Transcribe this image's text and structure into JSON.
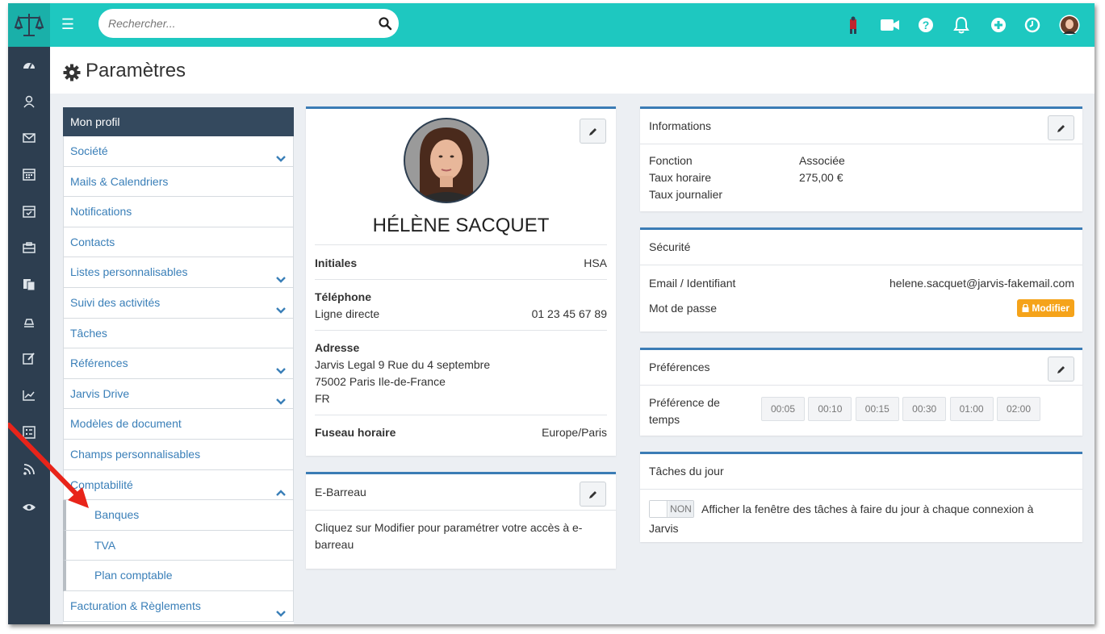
{
  "search": {
    "placeholder": "Rechercher..."
  },
  "header": {
    "title": "Paramètres"
  },
  "menu": {
    "head": "Mon profil",
    "items": [
      {
        "label": "Société",
        "chevron": "down"
      },
      {
        "label": "Mails & Calendriers"
      },
      {
        "label": "Notifications"
      },
      {
        "label": "Contacts"
      },
      {
        "label": "Listes personnalisables",
        "chevron": "down"
      },
      {
        "label": "Suivi des activités",
        "chevron": "down"
      },
      {
        "label": "Tâches"
      },
      {
        "label": "Références",
        "chevron": "down"
      },
      {
        "label": "Jarvis Drive",
        "chevron": "down"
      },
      {
        "label": "Modèles de document"
      },
      {
        "label": "Champs personnalisables"
      },
      {
        "label": "Comptabilité",
        "chevron": "up"
      },
      {
        "label": "Banques",
        "sub": true
      },
      {
        "label": "TVA",
        "sub": true
      },
      {
        "label": "Plan comptable",
        "sub": true
      },
      {
        "label": "Facturation & Règlements",
        "chevron": "down"
      }
    ]
  },
  "profile": {
    "name": "HÉLÈNE SACQUET",
    "initials_label": "Initiales",
    "initials_value": "HSA",
    "phone_label": "Téléphone",
    "direct_line_label": "Ligne directe",
    "direct_line_value": "01 23 45 67 89",
    "address_label": "Adresse",
    "address_line1": "Jarvis Legal 9 Rue du 4 septembre",
    "address_line2": "75002 Paris Ile-de-France",
    "address_line3": "FR",
    "timezone_label": "Fuseau horaire",
    "timezone_value": "Europe/Paris"
  },
  "ebarreau": {
    "title": "E-Barreau",
    "text_line1": "Cliquez sur Modifier pour paramétrer votre accès à e-",
    "text_line2": "barreau"
  },
  "informations": {
    "title": "Informations",
    "fonction_label": "Fonction",
    "fonction_value": "Associée",
    "taux_horaire_label": "Taux horaire",
    "taux_horaire_value": "275,00 €",
    "taux_journalier_label": "Taux journalier"
  },
  "securite": {
    "title": "Sécurité",
    "email_label": "Email / Identifiant",
    "email_value": "helene.sacquet@jarvis-fakemail.com",
    "password_label": "Mot de passe",
    "modify_label": "Modifier"
  },
  "preferences": {
    "title": "Préférences",
    "label_line1": "Préférence de",
    "label_line2": "temps",
    "times": [
      "00:05",
      "00:10",
      "00:15",
      "00:30",
      "01:00",
      "02:00"
    ]
  },
  "taches": {
    "title": "Tâches du jour",
    "toggle_label": "NON",
    "text_line1": "Afficher la fenêtre des tâches à faire du jour à chaque connexion à",
    "text_line2": "Jarvis"
  },
  "colors": {
    "topbar": "#1ec8c0",
    "sidebar": "#2d3e50",
    "accent_blue": "#3b7cb5",
    "link": "#3a7fb8",
    "warning": "#f5a31a",
    "annotation_arrow": "#e8241a"
  }
}
